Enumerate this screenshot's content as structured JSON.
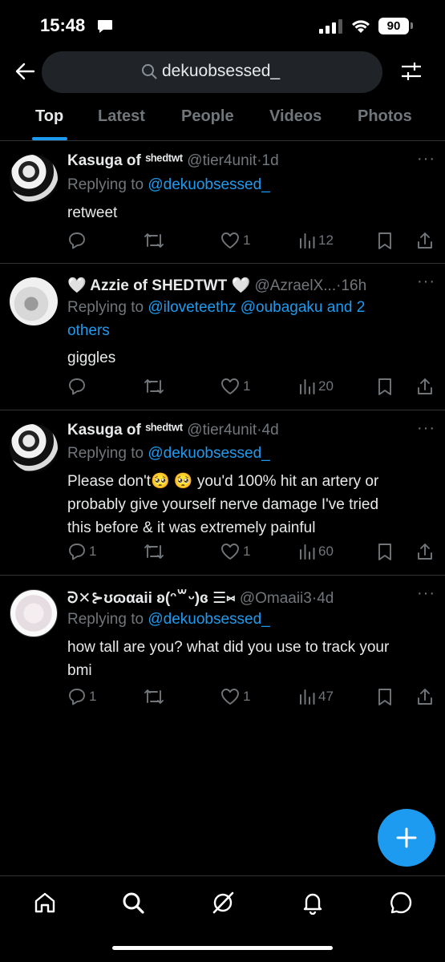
{
  "status": {
    "time": "15:48",
    "battery": "90"
  },
  "search": {
    "query": "dekuobsessed_"
  },
  "tabs": [
    {
      "label": "Top"
    },
    {
      "label": "Latest"
    },
    {
      "label": "People"
    },
    {
      "label": "Videos"
    },
    {
      "label": "Photos"
    }
  ],
  "tweets": [
    {
      "name": "Kasuga of ˢʰᵉᵈᵗʷᵗ",
      "handle": "@tier4unit",
      "time": "1d",
      "reply_prefix": "Replying to",
      "mentions": "@dekuobsessed_",
      "text": "retweet",
      "replies": "",
      "retweets": "",
      "likes": "1",
      "views": "12"
    },
    {
      "name": "🤍 Azzie of SHEDTWT 🤍",
      "handle": "@AzraelX...",
      "time": "16h",
      "reply_prefix": "Replying to",
      "mentions_1": "@iloveteethz @oubagaku and 2",
      "mentions_2": "others",
      "text": "giggles",
      "replies": "",
      "retweets": "",
      "likes": "1",
      "views": "20"
    },
    {
      "name": "Kasuga of ˢʰᵉᵈᵗʷᵗ",
      "handle": "@tier4unit",
      "time": "4d",
      "reply_prefix": "Replying to",
      "mentions": "@dekuobsessed_",
      "text_1": "Please don't🥺 🥺  you'd 100% hit an artery or",
      "text_2": "probably give yourself nerve damage I've tried",
      "text_3": "this before & it was extremely painful",
      "replies": "1",
      "retweets": "",
      "likes": "1",
      "views": "60"
    },
    {
      "name": "ᘒ✕⊱ʊɷαaii ʚ(ᵔ꒳ᵕ)ɞ ☰⑅",
      "handle": "@Omaaii3",
      "time": "4d",
      "reply_prefix": "Replying to",
      "mentions": "@dekuobsessed_",
      "text_1": "how tall are you? what did you use to track your",
      "text_2": "bmi",
      "replies": "1",
      "retweets": "",
      "likes": "1",
      "views": "47"
    }
  ],
  "colors": {
    "accent": "#1d9bf0",
    "muted": "#71767b",
    "divider": "#2f3336",
    "background": "#000000"
  },
  "icons": [
    "back-arrow-icon",
    "search-icon",
    "filter-icon",
    "reply-icon",
    "retweet-icon",
    "like-icon",
    "views-icon",
    "bookmark-icon",
    "share-icon",
    "compose-icon",
    "home-icon",
    "explore-icon",
    "grok-icon",
    "notifications-icon",
    "messages-icon"
  ]
}
